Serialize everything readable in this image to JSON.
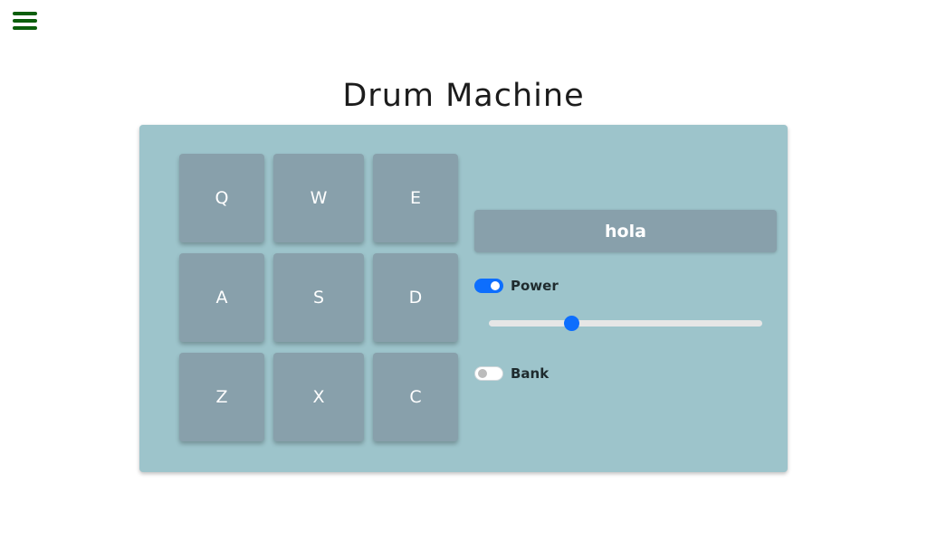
{
  "header": {
    "menu_icon": "hamburger-menu-icon",
    "menu_color": "#0b5e0b"
  },
  "title": "Drum Machine",
  "pads": [
    {
      "key": "Q"
    },
    {
      "key": "W"
    },
    {
      "key": "E"
    },
    {
      "key": "A"
    },
    {
      "key": "S"
    },
    {
      "key": "D"
    },
    {
      "key": "Z"
    },
    {
      "key": "X"
    },
    {
      "key": "C"
    }
  ],
  "controls": {
    "display_text": "hola",
    "power": {
      "label": "Power",
      "on": true
    },
    "volume": {
      "value": 0.3
    },
    "bank": {
      "label": "Bank",
      "on": false
    }
  },
  "colors": {
    "panel": "#9dc4cb",
    "pad": "#88a0ab",
    "accent": "#0d6efd"
  }
}
